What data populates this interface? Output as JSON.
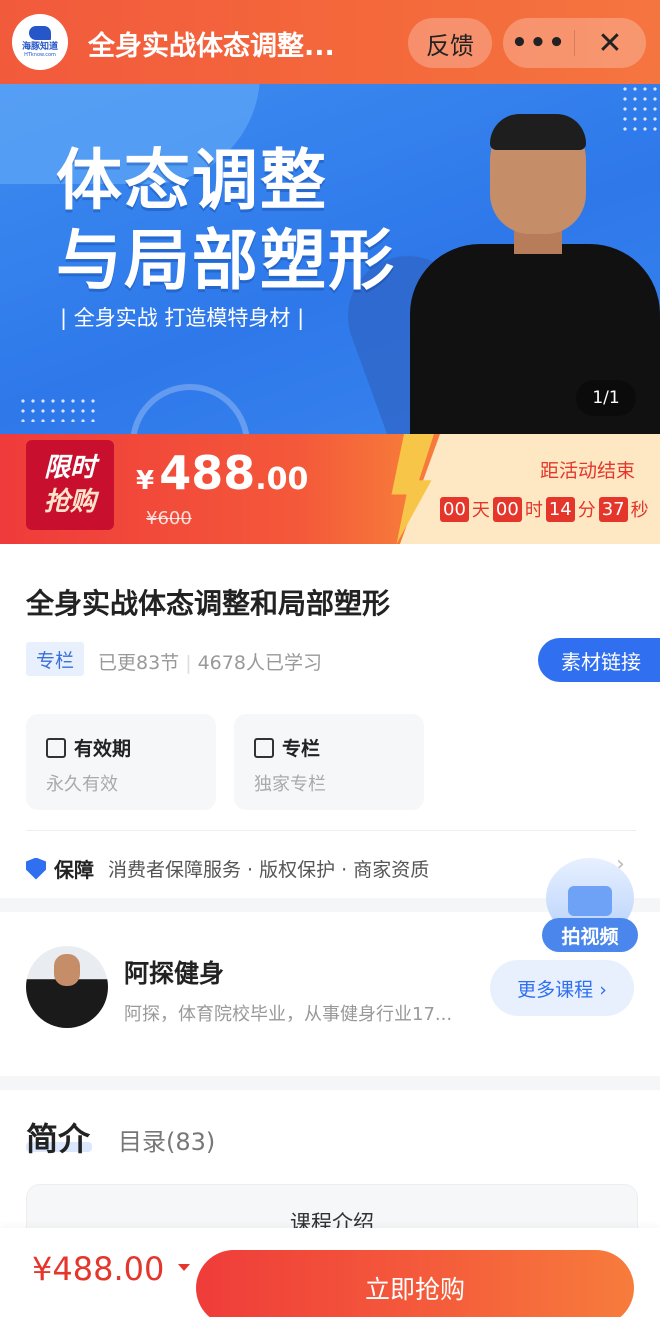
{
  "header": {
    "logo_text": "海豚知道",
    "logo_sub": "HTknow.com",
    "title": "全身实战体态调整...",
    "feedback_label": "反馈",
    "more_label": "•••",
    "close_label": "✕"
  },
  "banner": {
    "title_line1": "体态调整",
    "title_line2": "与局部塑形",
    "subtitle": "| 全身实战 打造模特身材 |",
    "page_indicator": "1/1"
  },
  "flash_sale": {
    "badge_line1": "限时",
    "badge_line2": "抢购",
    "currency": "¥",
    "price_int": "488",
    "price_dec": ".00",
    "original_price": "¥600",
    "ends_label": "距活动结束",
    "countdown": {
      "days": "00",
      "days_unit": "天",
      "hours": "00",
      "hours_unit": "时",
      "minutes": "14",
      "minutes_unit": "分",
      "seconds": "37",
      "seconds_unit": "秒"
    }
  },
  "course": {
    "title": "全身实战体态调整和局部塑形",
    "tag": "专栏",
    "updated": "已更83节",
    "learners": "4678人已学习",
    "material_button": "素材链接",
    "features": [
      {
        "title": "有效期",
        "value": "永久有效",
        "icon": "calendar-icon"
      },
      {
        "title": "专栏",
        "value": "独家专栏",
        "icon": "bookmark-icon"
      }
    ],
    "guarantee_label": "保障",
    "guarantee_text": "消费者保障服务 · 版权保护 · 商家资质"
  },
  "video_float": {
    "label": "拍视频"
  },
  "author": {
    "name": "阿探健身",
    "description": "阿探，体育院校毕业，从事健身行业17...",
    "more_courses": "更多课程 ›"
  },
  "tabs": {
    "active": "简介",
    "other": "目录(83)",
    "intro_card_title": "课程介绍"
  },
  "bottom": {
    "price": "¥488.00",
    "buy_label": "立即抢购"
  },
  "colors": {
    "brand_orange": "#f25a3c",
    "accent_blue": "#2f6ff0",
    "price_red": "#e5362c"
  }
}
